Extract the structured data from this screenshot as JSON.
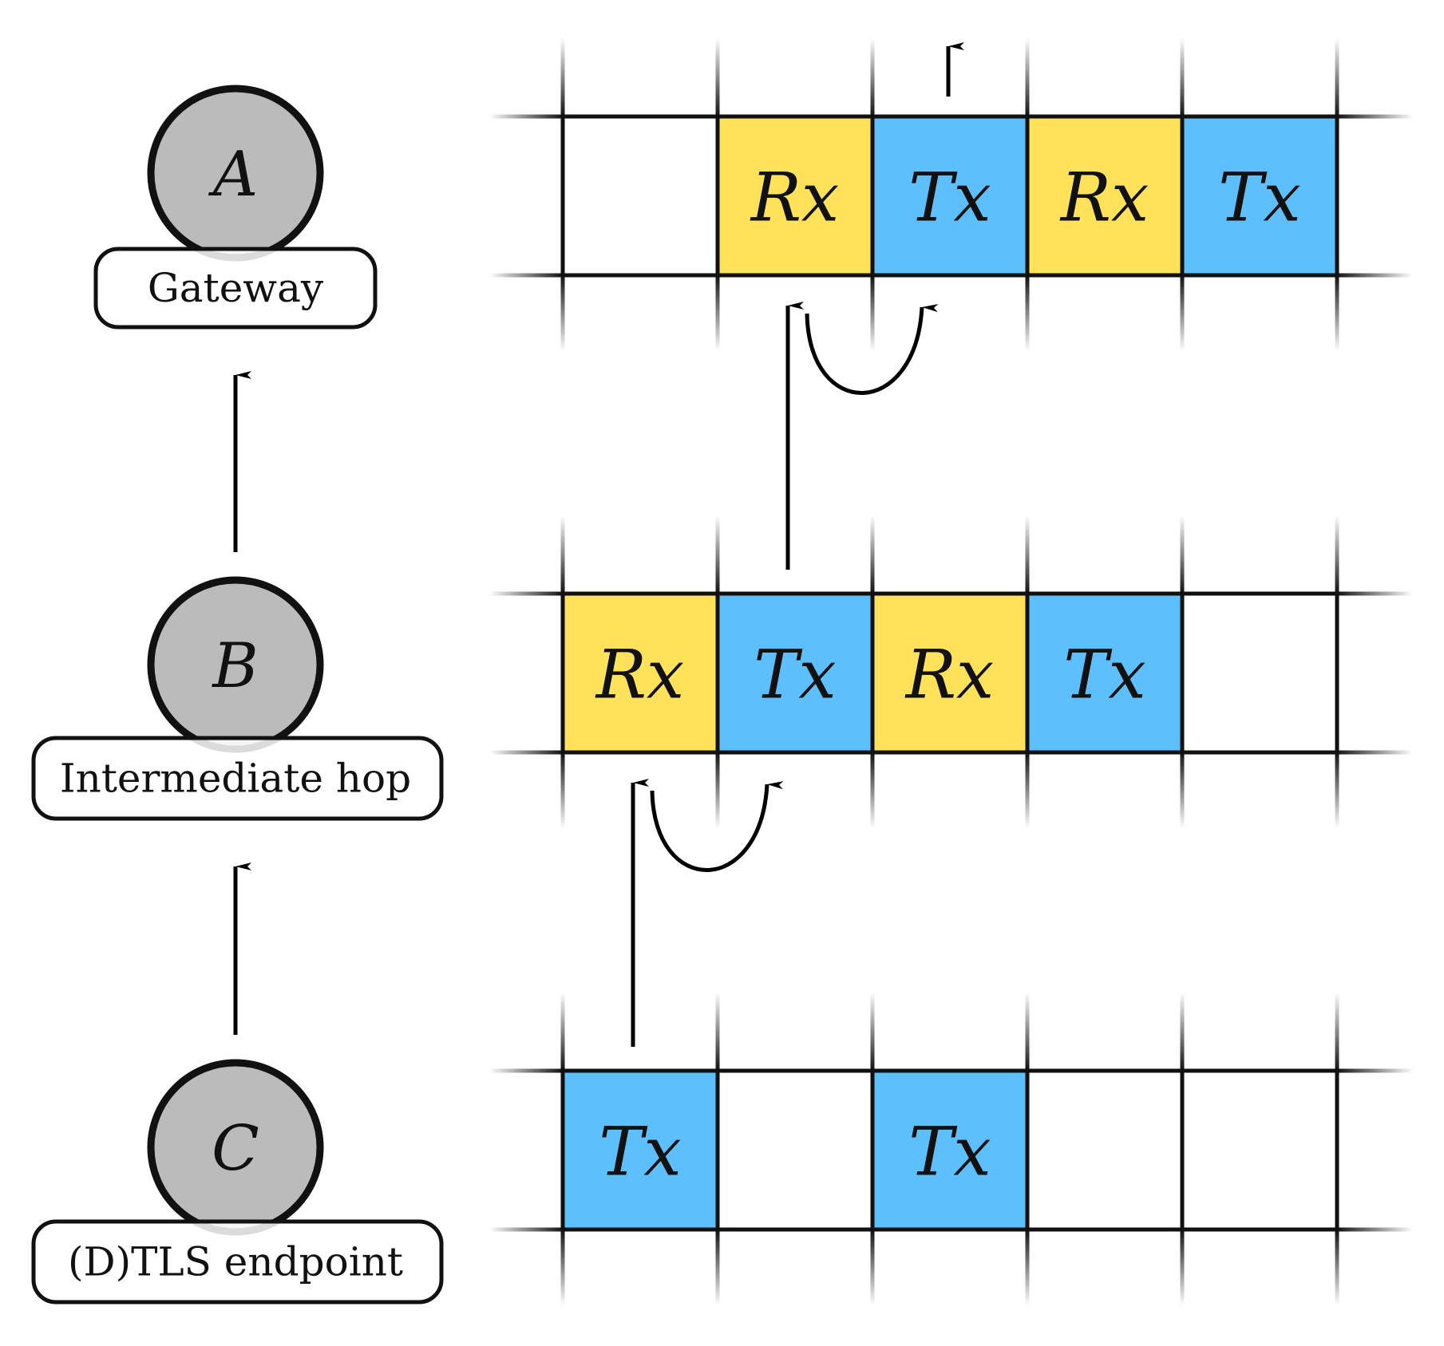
{
  "diagram": {
    "nodes": [
      {
        "id": "A",
        "letter": "A",
        "label": "Gateway"
      },
      {
        "id": "B",
        "letter": "B",
        "label": "Intermediate hop"
      },
      {
        "id": "C",
        "letter": "C",
        "label": "(D)TLS endpoint"
      }
    ],
    "node_edges": [
      {
        "from": "B",
        "to": "A"
      },
      {
        "from": "C",
        "to": "B"
      }
    ],
    "schedules": [
      {
        "node": "A",
        "slots": [
          "",
          "Rx",
          "Tx",
          "Rx",
          "Tx"
        ]
      },
      {
        "node": "B",
        "slots": [
          "Rx",
          "Tx",
          "Rx",
          "Tx",
          ""
        ]
      },
      {
        "node": "C",
        "slots": [
          "Tx",
          "",
          "Tx",
          "",
          ""
        ]
      }
    ],
    "slot_edges": [
      {
        "type": "forward",
        "from_row": 2,
        "from_slot": 0,
        "to_row": 1,
        "to_slot": 0
      },
      {
        "type": "relay",
        "row": 1,
        "from_slot": 0,
        "to_slot": 1
      },
      {
        "type": "forward",
        "from_row": 1,
        "from_slot": 1,
        "to_row": 0,
        "to_slot": 1
      },
      {
        "type": "relay",
        "row": 0,
        "from_slot": 1,
        "to_slot": 2
      },
      {
        "type": "exit",
        "row": 0,
        "slot": 2
      }
    ],
    "colors": {
      "rx": "#FFE15A",
      "tx": "#5EBFFD",
      "node_fill": "#BBBBBB",
      "stroke": "#111111"
    }
  }
}
